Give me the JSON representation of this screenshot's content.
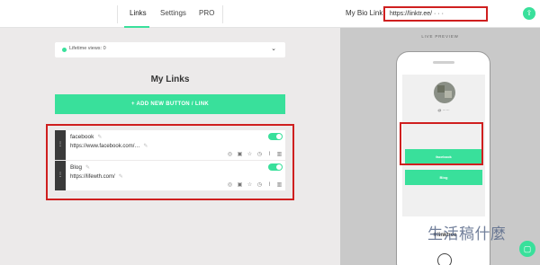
{
  "nav": {
    "tabs": [
      {
        "label": "Links"
      },
      {
        "label": "Settings"
      },
      {
        "label": "PRO"
      }
    ],
    "bio_label": "My Bio Link:",
    "bio_url": "https://linktr.ee/ · · ·"
  },
  "views": {
    "text": "Lifetime views: 0"
  },
  "main": {
    "title": "My Links",
    "add_button": "+ ADD NEW BUTTON / LINK",
    "links": [
      {
        "title": "facebook",
        "url": "https://www.facebook.com/…",
        "enabled": true
      },
      {
        "title": "Blog",
        "url": "https://lifewth.com/",
        "enabled": true
      }
    ]
  },
  "preview": {
    "heading": "LIVE PREVIEW",
    "username": "@ ······",
    "buttons": [
      "facebook",
      "Blog"
    ],
    "brand": "linktree"
  },
  "watermark": "生活稿什麼",
  "colors": {
    "accent": "#39e09b",
    "highlight": "#cf1f1f",
    "panel_bg": "#eceaea",
    "preview_bg": "#c9c9c9"
  }
}
